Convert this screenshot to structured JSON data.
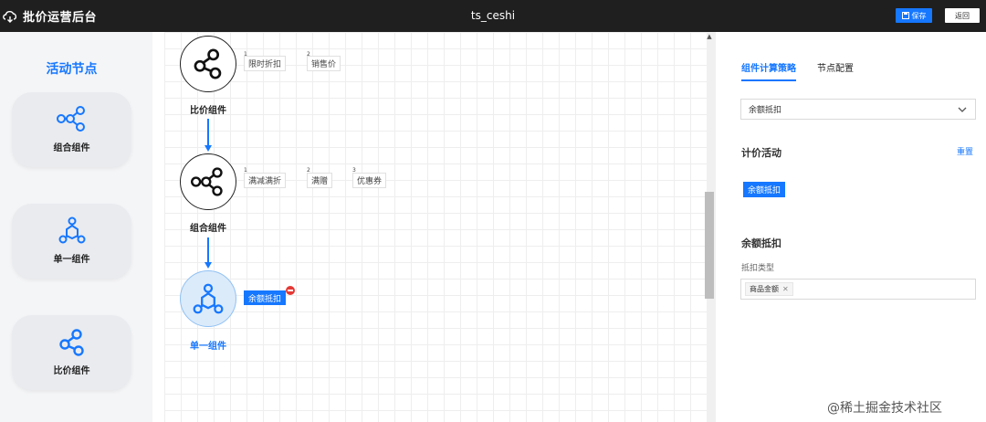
{
  "header": {
    "app_title": "批价运营后台",
    "page_name": "ts_ceshi",
    "save_label": "保存",
    "back_label": "返回",
    "bg_color": "#1f1f1f",
    "accent_color": "#1677ff"
  },
  "left_panel": {
    "title": "活动节点",
    "cards": [
      {
        "label": "组合组件",
        "icon": "combo-node-icon"
      },
      {
        "label": "单一组件",
        "icon": "single-node-icon"
      },
      {
        "label": "比价组件",
        "icon": "compare-node-icon"
      }
    ]
  },
  "canvas": {
    "nodes": [
      {
        "label": "比价组件",
        "icon": "compare-node-icon",
        "tags": [
          {
            "index": "1",
            "label": "限时折扣"
          },
          {
            "index": "2",
            "label": "销售价"
          }
        ]
      },
      {
        "label": "组合组件",
        "icon": "combo-node-icon",
        "tags": [
          {
            "index": "1",
            "label": "满减满折"
          },
          {
            "index": "2",
            "label": "满赠"
          },
          {
            "index": "3",
            "label": "优惠券"
          }
        ]
      },
      {
        "label": "单一组件",
        "icon": "single-node-icon",
        "selected": true,
        "tags": [
          {
            "label": "余额抵扣"
          }
        ]
      }
    ]
  },
  "right_panel": {
    "tabs": [
      {
        "label": "组件计算策略",
        "active": true
      },
      {
        "label": "节点配置",
        "active": false
      }
    ],
    "strategy_select": {
      "value": "余额抵扣"
    },
    "pricing_activity": {
      "title": "计价活动",
      "reset_label": "重置",
      "chips": [
        "余额抵扣"
      ]
    },
    "detail": {
      "title": "余额抵扣",
      "field_label": "抵扣类型",
      "selected_values": [
        "商品金额"
      ]
    }
  },
  "watermark": "@稀土掘金技术社区"
}
